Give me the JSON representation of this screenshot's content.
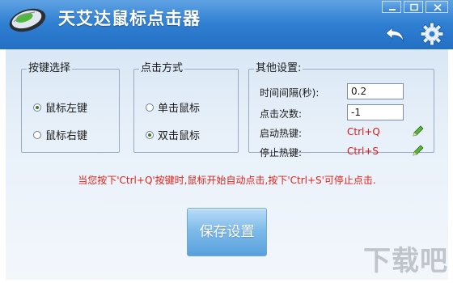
{
  "app": {
    "title": "天艾达鼠标点击器"
  },
  "key_group": {
    "legend": "按键选择",
    "options": [
      {
        "label": "鼠标左键",
        "checked": true
      },
      {
        "label": "鼠标右键",
        "checked": false
      }
    ]
  },
  "mode_group": {
    "legend": "点击方式",
    "options": [
      {
        "label": "单击鼠标",
        "checked": false
      },
      {
        "label": "双击鼠标",
        "checked": true
      }
    ]
  },
  "other_group": {
    "legend": "其他设置:",
    "interval_label": "时间间隔(秒):",
    "interval_value": "0.2",
    "count_label": "点击次数:",
    "count_value": "-1",
    "start_label": "启动热键:",
    "start_hotkey": "Ctrl+Q",
    "stop_label": "停止热键:",
    "stop_hotkey": "Ctrl+S"
  },
  "hint": "当您按下'Ctrl+Q'按键时,鼠标开始自动点击,按下'Ctrl+S'可停止点击.",
  "save_label": "保存设置",
  "watermark": "下载吧",
  "colors": {
    "titlebar": "#2f7fd2",
    "hotkey": "#d11a1a",
    "hint": "#e0231a",
    "save_button": "#7fbbe9"
  },
  "icons": {
    "logo": "mouse-logo-icon",
    "back": "back-arrow-icon",
    "settings": "gear-icon",
    "edit": "pencil-icon"
  }
}
